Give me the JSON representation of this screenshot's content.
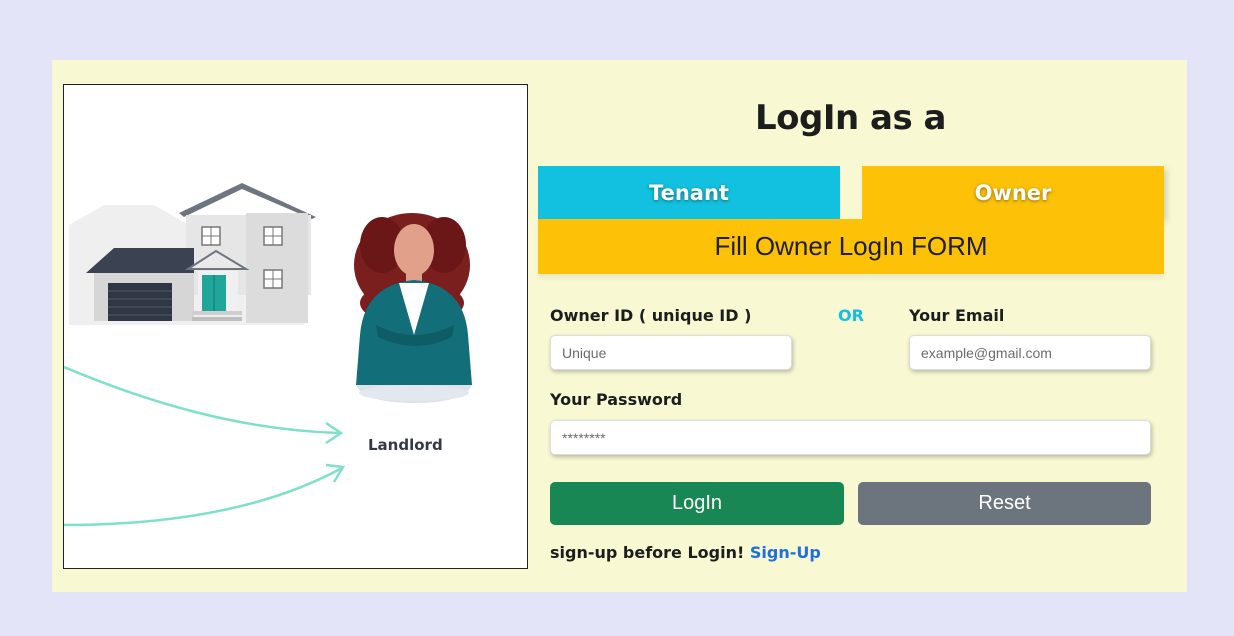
{
  "illustration": {
    "role_label": "Landlord"
  },
  "heading": "LogIn as a",
  "tabs": [
    {
      "label": "Tenant"
    },
    {
      "label": "Owner"
    }
  ],
  "form_title": "Fill Owner LogIn FORM",
  "fields": {
    "owner_id_label": "Owner ID ( unique ID )",
    "or_text": "OR",
    "email_label": "Your Email",
    "owner_id_placeholder": "Unique",
    "email_placeholder": "example@gmail.com",
    "password_label": "Your Password",
    "password_placeholder": "********"
  },
  "buttons": {
    "login": "LogIn",
    "reset": "Reset"
  },
  "signup": {
    "prompt": "sign-up before Login!",
    "link": "Sign-Up"
  },
  "colors": {
    "page_bg": "#e4e4f9",
    "card_bg": "#f8f8d3",
    "tenant_tab": "#12c0df",
    "owner_tab": "#fdc107",
    "login_button": "#198754",
    "reset_button": "#6c757d",
    "link": "#1e6fe0"
  }
}
